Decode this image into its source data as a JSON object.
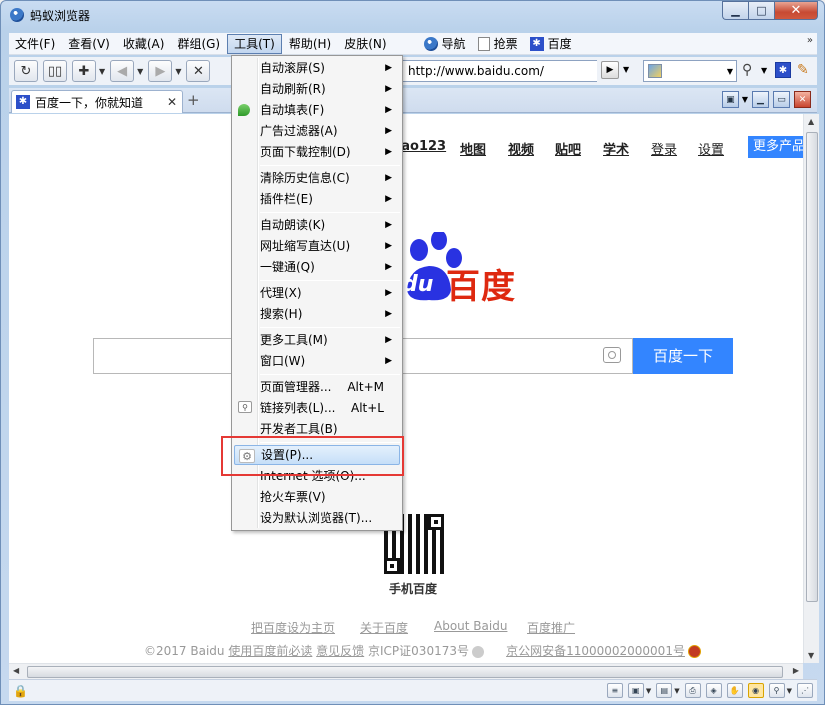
{
  "window": {
    "title": "蚂蚁浏览器",
    "minimize_label": "▁",
    "maximize_label": "□",
    "close_label": "✕"
  },
  "menubar": {
    "items": [
      "文件(F)",
      "查看(V)",
      "收藏(A)",
      "群组(G)",
      "工具(T)",
      "帮助(H)",
      "皮肤(N)"
    ],
    "quick": [
      "导航",
      "抢票",
      "百度"
    ],
    "overflow": "»"
  },
  "toolbar": {
    "address": "http://www.baidu.com/"
  },
  "tabs": [
    {
      "title": "百度一下，你就知道"
    }
  ],
  "tools_menu": {
    "items": [
      {
        "label": "自动滚屏(S)",
        "submenu": true
      },
      {
        "label": "自动刷新(R)",
        "submenu": true
      },
      {
        "label": "自动填表(F)",
        "submenu": true,
        "icon": "form-fill-icon"
      },
      {
        "label": "广告过滤器(A)",
        "submenu": true
      },
      {
        "label": "页面下载控制(D)",
        "submenu": true
      },
      {
        "label": "清除历史信息(C)",
        "submenu": true
      },
      {
        "label": "插件栏(E)",
        "submenu": true
      },
      {
        "label": "自动朗读(K)",
        "submenu": true
      },
      {
        "label": "网址缩写直达(U)",
        "submenu": true
      },
      {
        "label": "一键通(Q)",
        "submenu": true
      },
      {
        "label": "代理(X)",
        "submenu": true
      },
      {
        "label": "搜索(H)",
        "submenu": true
      },
      {
        "label": "更多工具(M)",
        "submenu": true
      },
      {
        "label": "窗口(W)",
        "submenu": true
      },
      {
        "label": "页面管理器...",
        "shortcut": "Alt+M"
      },
      {
        "label": "链接列表(L)...",
        "shortcut": "Alt+L",
        "icon": "link-list-icon"
      },
      {
        "label": "开发者工具(B)"
      },
      {
        "label": "设置(P)...",
        "icon": "wrench-icon",
        "highlighted": true
      },
      {
        "label": "Internet 选项(O)..."
      },
      {
        "label": "抢火车票(V)"
      },
      {
        "label": "设为默认浏览器(T)..."
      }
    ]
  },
  "baidu": {
    "nav": [
      "hao123",
      "地图",
      "视频",
      "贴吧",
      "学术",
      "登录",
      "设置"
    ],
    "more": "更多产品",
    "logo_text": "百度",
    "logo_du": "du",
    "search_button": "百度一下",
    "qr_label": "手机百度",
    "footer_links": [
      "把百度设为主页",
      "关于百度",
      "About Baidu",
      "百度推广"
    ],
    "copyright_prefix": "©2017 Baidu",
    "copyright_link1": "使用百度前必读",
    "copyright_link2": "意见反馈",
    "icp": "京ICP证030173号",
    "police": "京公网安备11000002000001号"
  },
  "colors": {
    "baidu_blue": "#3385ff",
    "baidu_red": "#de2910",
    "highlight_box": "#e53935"
  }
}
